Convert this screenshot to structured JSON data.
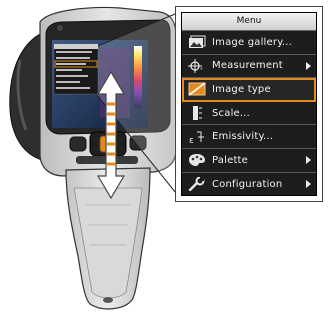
{
  "menu": {
    "title": "Menu",
    "items": [
      {
        "label": "Image gallery...",
        "icon": "image-gallery-icon",
        "has_submenu": false,
        "selected": false
      },
      {
        "label": "Measurement",
        "icon": "measurement-icon",
        "has_submenu": true,
        "selected": false
      },
      {
        "label": "Image type",
        "icon": "image-type-icon",
        "has_submenu": false,
        "selected": true
      },
      {
        "label": "Scale...",
        "icon": "scale-icon",
        "has_submenu": false,
        "selected": false
      },
      {
        "label": "Emissivity...",
        "icon": "emissivity-icon",
        "has_submenu": false,
        "selected": false
      },
      {
        "label": "Palette",
        "icon": "palette-icon",
        "has_submenu": true,
        "selected": false
      },
      {
        "label": "Configuration",
        "icon": "wrench-icon",
        "has_submenu": true,
        "selected": false
      }
    ]
  },
  "colors": {
    "menu_background": "#1d1d1d",
    "selection_highlight": "#e48a1c",
    "menu_text": "#f2f2f2",
    "camera_body": "#d0d0d0",
    "camera_dark": "#2b2b2b"
  }
}
